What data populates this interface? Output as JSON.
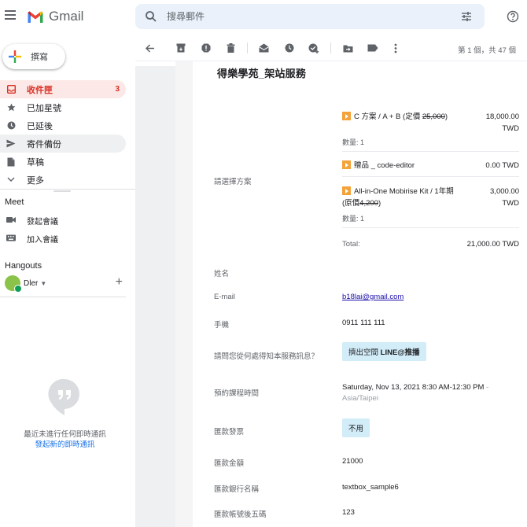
{
  "header": {
    "app_name": "Gmail",
    "search_placeholder": "搜尋郵件"
  },
  "sidebar": {
    "compose_label": "撰寫",
    "items": [
      {
        "label": "收件匣",
        "count": "3",
        "icon": "inbox-icon"
      },
      {
        "label": "已加星號",
        "icon": "star-icon"
      },
      {
        "label": "已延後",
        "icon": "clock-icon"
      },
      {
        "label": "寄件備份",
        "icon": "send-icon"
      },
      {
        "label": "草稿",
        "icon": "draft-icon"
      },
      {
        "label": "更多",
        "icon": "chevron-down-icon"
      }
    ],
    "meet": {
      "title": "Meet",
      "items": [
        {
          "label": "發起會議",
          "icon": "video-icon"
        },
        {
          "label": "加入會議",
          "icon": "keyboard-icon"
        }
      ]
    },
    "hangouts": {
      "title": "Hangouts",
      "user": "Dler",
      "empty_text": "最近未進行任何即時通訊",
      "start_link": "發起新的即時通訊"
    }
  },
  "toolbar": {
    "pager": "第 1 個，共 47 個"
  },
  "email": {
    "title": "得樂學苑_架站服務",
    "plan_label": "請選擇方案",
    "packages": [
      {
        "name_prefix": "C 方案 / A + B (定價 ",
        "name_strike": "25,000",
        "name_suffix": ")",
        "price": "18,000.00",
        "currency": "TWD",
        "qty": "數量: 1"
      },
      {
        "name": "贈品 _ code-editor",
        "price": "0.00 TWD"
      },
      {
        "name_line1": "All-in-One Mobirise Kit / 1年期",
        "name_line2_prefix": "(原價",
        "name_line2_strike": "4,200",
        "name_line2_suffix": ")",
        "price": "3,000.00",
        "currency": "TWD",
        "qty": "數量: 1"
      }
    ],
    "total_label": "Total:",
    "total_value": "21,000.00 TWD",
    "fields": {
      "name_label": "姓名",
      "email_label": "E-mail",
      "email_value": "b18lai@gmail.com",
      "phone_label": "手機",
      "phone_value": "0911 111 111",
      "source_label": "請問您從何處得知本服務訊息？",
      "source_value_prefix": "擠出空間 ",
      "source_value_bold": "LINE@推播",
      "time_label": "預約課程時間",
      "time_value": "Saturday, Nov 13, 2021 8:30 AM-12:30 PM",
      "time_dash": " -",
      "timezone": "Asia/Taipei",
      "invoice_label": "匯款發票",
      "invoice_value": "不用",
      "amount_label": "匯款金額",
      "amount_value": "21000",
      "bank_label": "匯款銀行名稱",
      "bank_value": "textbox_sample6",
      "acct_label": "匯款帳號後五碼",
      "acct_value": "123"
    }
  },
  "colors": {
    "inbox_red": "#d93025",
    "accent_blue": "#1a73e8",
    "chip_bg": "#d2ecf8",
    "search_bg": "#eaf1fb"
  }
}
